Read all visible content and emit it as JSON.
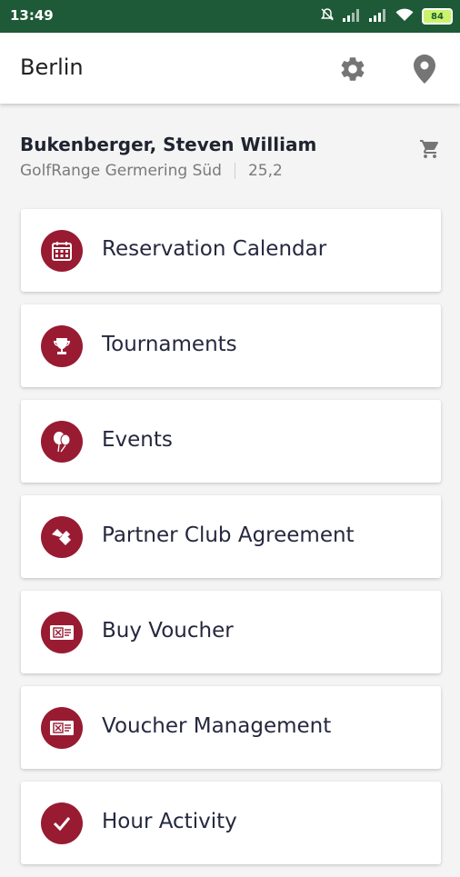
{
  "status_bar": {
    "time": "13:49",
    "battery": "84",
    "icons": [
      "mute-icon",
      "signal-icon",
      "signal-icon",
      "wifi-icon",
      "battery-icon"
    ],
    "background": "#1e5a37"
  },
  "app_bar": {
    "title": "Berlin",
    "icons": [
      "gear-icon",
      "location-pin-icon"
    ]
  },
  "profile": {
    "name": "Bukenberger, Steven William",
    "club": "GolfRange Germering Süd",
    "handicap": "25,2",
    "cart_icon": "shopping-cart-icon"
  },
  "menu": {
    "accent_color": "#981b32",
    "items": [
      {
        "label": "Reservation Calendar",
        "icon": "calendar-icon"
      },
      {
        "label": "Tournaments",
        "icon": "trophy-icon"
      },
      {
        "label": "Events",
        "icon": "balloon-icon"
      },
      {
        "label": "Partner Club Agreement",
        "icon": "handshake-icon"
      },
      {
        "label": "Buy Voucher",
        "icon": "voucher-icon"
      },
      {
        "label": "Voucher Management",
        "icon": "voucher-icon"
      },
      {
        "label": "Hour Activity",
        "icon": "checkmark-icon"
      }
    ]
  }
}
